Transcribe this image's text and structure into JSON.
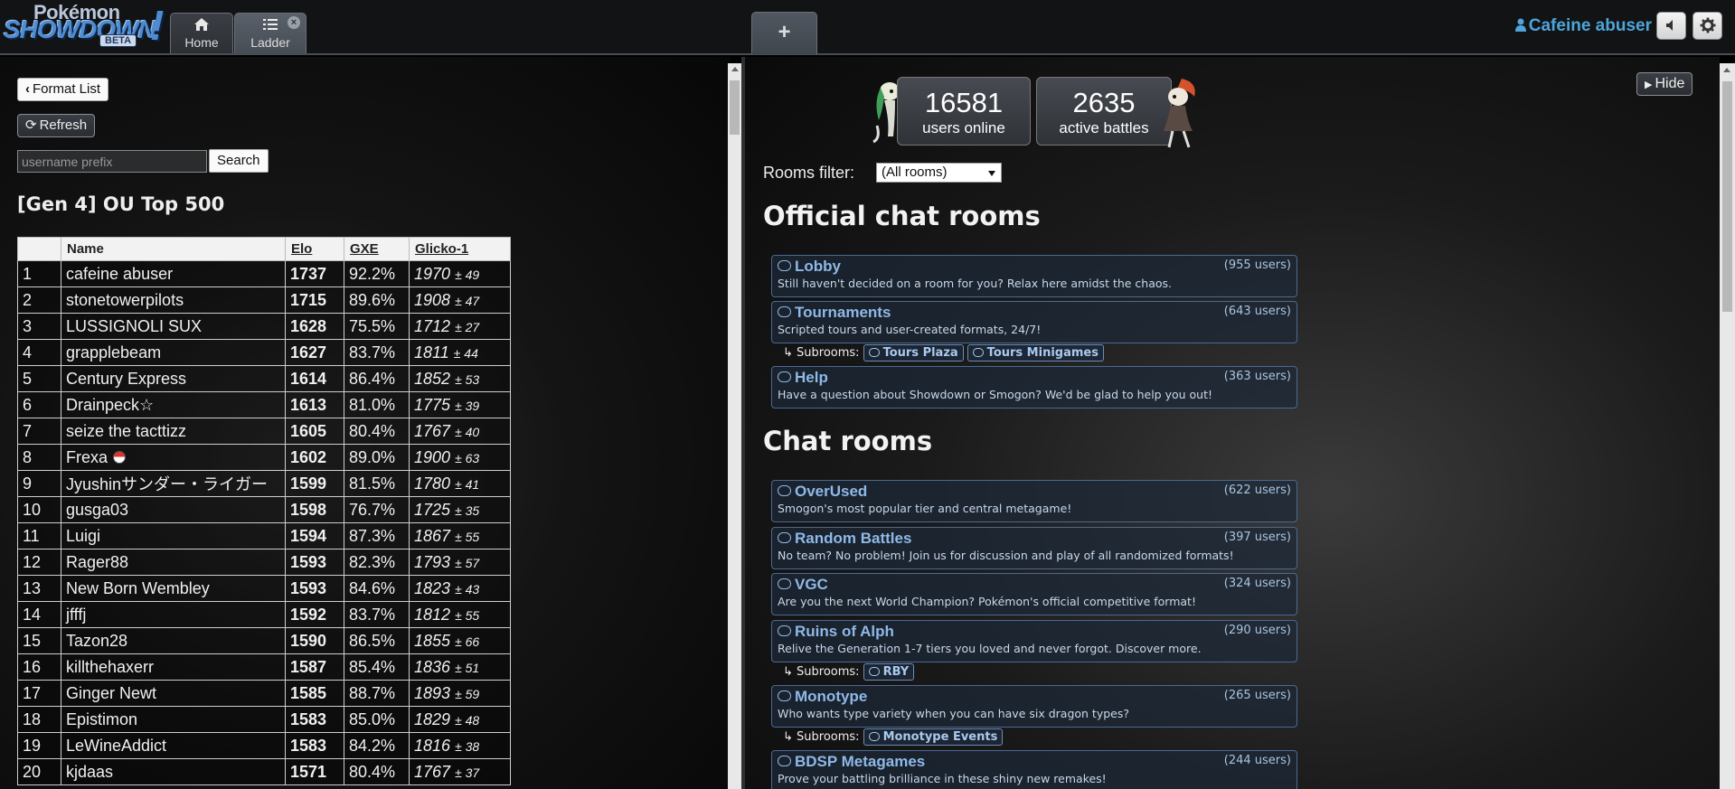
{
  "header": {
    "logo": {
      "line1": "Pokémon",
      "line2": "SHOWDOWN",
      "badge": "BETA",
      "mark": "!"
    },
    "tabs": [
      {
        "label": "Home",
        "icon": "home-icon"
      },
      {
        "label": "Ladder",
        "icon": "list-icon",
        "close": "×"
      }
    ],
    "new_tab_label": "+",
    "username": "Cafeine abuser",
    "sound_icon": "speaker-icon",
    "options_icon": "gear-icon"
  },
  "ladder": {
    "format_list_label": "Format List",
    "refresh_label": "Refresh",
    "search_placeholder": "username prefix",
    "search_button_label": "Search",
    "title": "[Gen 4] OU Top 500",
    "columns": [
      "",
      "Name",
      "Elo",
      "GXE",
      "Glicko-1"
    ],
    "rows": [
      {
        "rank": "1",
        "name": "cafeine abuser",
        "elo": "1737",
        "gxe": "92.2%",
        "glicko": "1970",
        "dev": "± 49"
      },
      {
        "rank": "2",
        "name": "stonetowerpilots",
        "elo": "1715",
        "gxe": "89.6%",
        "glicko": "1908",
        "dev": "± 47"
      },
      {
        "rank": "3",
        "name": "LUSSIGNOLI SUX",
        "elo": "1628",
        "gxe": "75.5%",
        "glicko": "1712",
        "dev": "± 27"
      },
      {
        "rank": "4",
        "name": "grapplebeam",
        "elo": "1627",
        "gxe": "83.7%",
        "glicko": "1811",
        "dev": "± 44"
      },
      {
        "rank": "5",
        "name": "Century Express",
        "elo": "1614",
        "gxe": "86.4%",
        "glicko": "1852",
        "dev": "± 53"
      },
      {
        "rank": "6",
        "name": "Drainpeck☆",
        "elo": "1613",
        "gxe": "81.0%",
        "glicko": "1775",
        "dev": "± 39"
      },
      {
        "rank": "7",
        "name": "seize the tacttizz",
        "elo": "1605",
        "gxe": "80.4%",
        "glicko": "1767",
        "dev": "± 40"
      },
      {
        "rank": "8",
        "name": "Frexa",
        "elo": "1602",
        "gxe": "89.0%",
        "glicko": "1900",
        "dev": "± 63",
        "badge": "pokeball-icon"
      },
      {
        "rank": "9",
        "name": "Jyushinサンダー・ライガー",
        "elo": "1599",
        "gxe": "81.5%",
        "glicko": "1780",
        "dev": "± 41"
      },
      {
        "rank": "10",
        "name": "gusga03",
        "elo": "1598",
        "gxe": "76.7%",
        "glicko": "1725",
        "dev": "± 35"
      },
      {
        "rank": "11",
        "name": "Luigi",
        "elo": "1594",
        "gxe": "87.3%",
        "glicko": "1867",
        "dev": "± 55"
      },
      {
        "rank": "12",
        "name": "Rager88",
        "elo": "1593",
        "gxe": "82.3%",
        "glicko": "1793",
        "dev": "± 57"
      },
      {
        "rank": "13",
        "name": "New Born Wembley",
        "elo": "1593",
        "gxe": "84.6%",
        "glicko": "1823",
        "dev": "± 43"
      },
      {
        "rank": "14",
        "name": "jfffj",
        "elo": "1592",
        "gxe": "83.7%",
        "glicko": "1812",
        "dev": "± 55"
      },
      {
        "rank": "15",
        "name": "Tazon28",
        "elo": "1590",
        "gxe": "86.5%",
        "glicko": "1855",
        "dev": "± 66"
      },
      {
        "rank": "16",
        "name": "killthehaxerr",
        "elo": "1587",
        "gxe": "85.4%",
        "glicko": "1836",
        "dev": "± 51"
      },
      {
        "rank": "17",
        "name": "Ginger Newt",
        "elo": "1585",
        "gxe": "88.7%",
        "glicko": "1893",
        "dev": "± 59"
      },
      {
        "rank": "18",
        "name": "Epistimon",
        "elo": "1583",
        "gxe": "85.0%",
        "glicko": "1829",
        "dev": "± 48"
      },
      {
        "rank": "19",
        "name": "LeWineAddict",
        "elo": "1583",
        "gxe": "84.2%",
        "glicko": "1816",
        "dev": "± 38"
      },
      {
        "rank": "20",
        "name": "kjdaas",
        "elo": "1571",
        "gxe": "80.4%",
        "glicko": "1767",
        "dev": "± 37"
      }
    ]
  },
  "home": {
    "hide_label": "Hide",
    "users_online": "16581",
    "users_online_label": "users online",
    "active_battles": "2635",
    "active_battles_label": "active battles",
    "rooms_filter_label": "Rooms filter:",
    "rooms_filter_value": "(All rooms)",
    "official_heading": "Official chat rooms",
    "official_rooms": [
      {
        "name": "Lobby",
        "users": "(955 users)",
        "desc": "Still haven't decided on a room for you? Relax here amidst the chaos."
      },
      {
        "name": "Tournaments",
        "users": "(643 users)",
        "desc": "Scripted tours and user-created formats, 24/7!",
        "subrooms_label": "↳ Subrooms:",
        "subrooms": [
          "Tours Plaza",
          "Tours Minigames"
        ]
      },
      {
        "name": "Help",
        "users": "(363 users)",
        "desc": "Have a question about Showdown or Smogon? We'd be glad to help you out!"
      }
    ],
    "chat_heading": "Chat rooms",
    "chat_rooms": [
      {
        "name": "OverUsed",
        "users": "(622 users)",
        "desc": "Smogon's most popular tier and central metagame!"
      },
      {
        "name": "Random Battles",
        "users": "(397 users)",
        "desc": "No team? No problem! Join us for discussion and play of all randomized formats!"
      },
      {
        "name": "VGC",
        "users": "(324 users)",
        "desc": "Are you the next World Champion? Pokémon's official competitive format!"
      },
      {
        "name": "Ruins of Alph",
        "users": "(290 users)",
        "desc": "Relive the Generation 1-7 tiers you loved and never forgot. Discover more.",
        "subrooms_label": "↳ Subrooms:",
        "subrooms": [
          "RBY"
        ]
      },
      {
        "name": "Monotype",
        "users": "(265 users)",
        "desc": "Who wants type variety when you can have six dragon types?",
        "subrooms_label": "↳ Subrooms:",
        "subrooms": [
          "Monotype Events"
        ]
      },
      {
        "name": "BDSP Metagames",
        "users": "(244 users)",
        "desc": "Prove your battling brilliance in these shiny new remakes!"
      }
    ]
  }
}
